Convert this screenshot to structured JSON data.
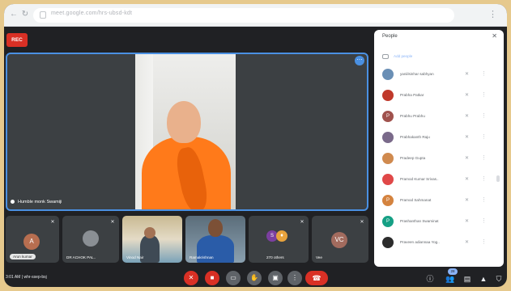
{
  "browser": {
    "url": "meet.google.com/hrs-ubsd-kdt",
    "menu_icon": "more-vert-icon"
  },
  "recording": {
    "badge": "REC"
  },
  "stage": {
    "speaker_name": "Humble monk Swamiji",
    "more_icon": "more-vert-icon"
  },
  "tiles": [
    {
      "initial": "A",
      "label": "Arun kumar",
      "avatar_color": "#b76e50"
    },
    {
      "initial": "",
      "label": "DR ACHOK PAL..",
      "avatar_color": "#8a8f94"
    },
    {
      "initial": "",
      "label": "Vinod Nair",
      "avatar_color": ""
    },
    {
      "initial": "",
      "label": "Ramakrishnan",
      "avatar_color": ""
    },
    {
      "initial": "",
      "label": "270 others",
      "avatar_color": "#7b3fa0"
    },
    {
      "initial": "VC",
      "label": "Vee",
      "avatar_color": "#a26b5e"
    }
  ],
  "panel": {
    "title": "People",
    "close_icon": "close-icon",
    "add_label": "Add people",
    "people": [
      {
        "name": "yaniilsinhar sabhyan",
        "initial": "",
        "color": "#6a8fb5"
      },
      {
        "name": "Prabha Patkar",
        "initial": "",
        "color": "#c0392b"
      },
      {
        "name": "Prabhu Prabhu",
        "initial": "P",
        "color": "#a0524d"
      },
      {
        "name": "Prabhakanth Raju",
        "initial": "",
        "color": "#7a6a8a"
      },
      {
        "name": "Pradeep Gupta",
        "initial": "",
        "color": "#d08a4f"
      },
      {
        "name": "Pramod Kumar Srivas..",
        "initial": "",
        "color": "#e04848"
      },
      {
        "name": "Pramod Sahmanat",
        "initial": "P",
        "color": "#d4833f"
      },
      {
        "name": "Prashanthan Swaminat",
        "initial": "P",
        "color": "#16a085"
      },
      {
        "name": "Praveen adiannaa Yog..",
        "initial": "",
        "color": "#2c2c2c"
      }
    ]
  },
  "bottom": {
    "time_label": "3:01 AM",
    "meeting_code": "whr-ssep-bsj",
    "participant_count": "28"
  },
  "controls": [
    {
      "name": "mic-off-icon",
      "glyph": "✕"
    },
    {
      "name": "camera-off-icon",
      "glyph": "■"
    },
    {
      "name": "captions-icon",
      "glyph": "▭"
    },
    {
      "name": "raise-hand-icon",
      "glyph": "✋"
    },
    {
      "name": "present-icon",
      "glyph": "▣"
    },
    {
      "name": "more-options-icon",
      "glyph": "⋮"
    }
  ],
  "leave_glyph": "☎"
}
